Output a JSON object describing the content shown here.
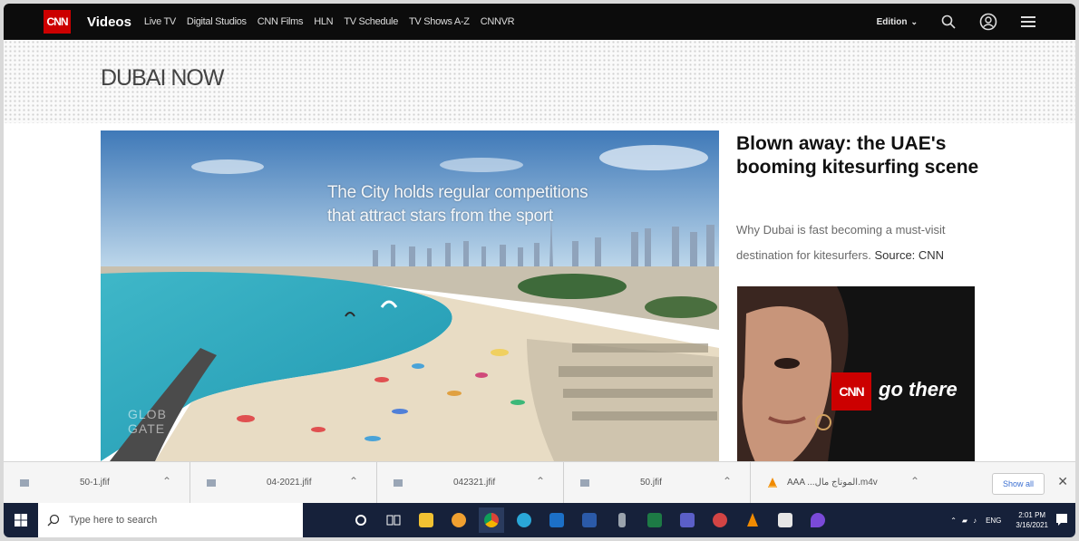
{
  "cnn": {
    "logo_text": "CNN",
    "section": "Videos",
    "nav": [
      "Live TV",
      "Digital Studios",
      "CNN Films",
      "HLN",
      "TV Schedule",
      "TV Shows A-Z",
      "CNNVR"
    ],
    "edition_label": "Edition",
    "icons": [
      "search-icon",
      "user-account-icon",
      "menu-icon"
    ]
  },
  "banner": {
    "title": "DUBAI NOW"
  },
  "hero": {
    "caption_line1": "The City holds regular competitions",
    "caption_line2": "that attract stars from the sport",
    "watermark_line1": "GLOB",
    "watermark_line2": "GATE"
  },
  "story": {
    "headline": "Blown away: the UAE's booming kitesurfing scene",
    "summary": "Why Dubai is fast becoming a must-visit destination for kitesurfers.",
    "source": "Source: CNN"
  },
  "ad": {
    "logo_text": "CNN",
    "tagline": "go there"
  },
  "downloads": {
    "items": [
      {
        "name": "50-1.jfif",
        "icon": "image-file-icon"
      },
      {
        "name": "04-2021.jfif",
        "icon": "image-file-icon"
      },
      {
        "name": "042321.jfif",
        "icon": "image-file-icon"
      },
      {
        "name": "50.jfif",
        "icon": "image-file-icon"
      },
      {
        "name": "AAA ...الموناج مال.m4v",
        "icon": "vlc-file-icon"
      }
    ],
    "show_all_label": "Show all"
  },
  "taskbar": {
    "search_placeholder": "Type here to search",
    "apps": [
      "cortana-icon",
      "task-view-icon",
      "file-explorer-icon",
      "chrome-canary-icon",
      "chrome-icon",
      "edge-icon",
      "outlook-icon",
      "word-icon",
      "usb-icon",
      "excel-icon",
      "teams-icon",
      "photos-icon",
      "vlc-icon",
      "store-icon",
      "paint-icon"
    ],
    "lang": "ENG",
    "time": "2:01 PM",
    "date": "3/16/2021"
  }
}
